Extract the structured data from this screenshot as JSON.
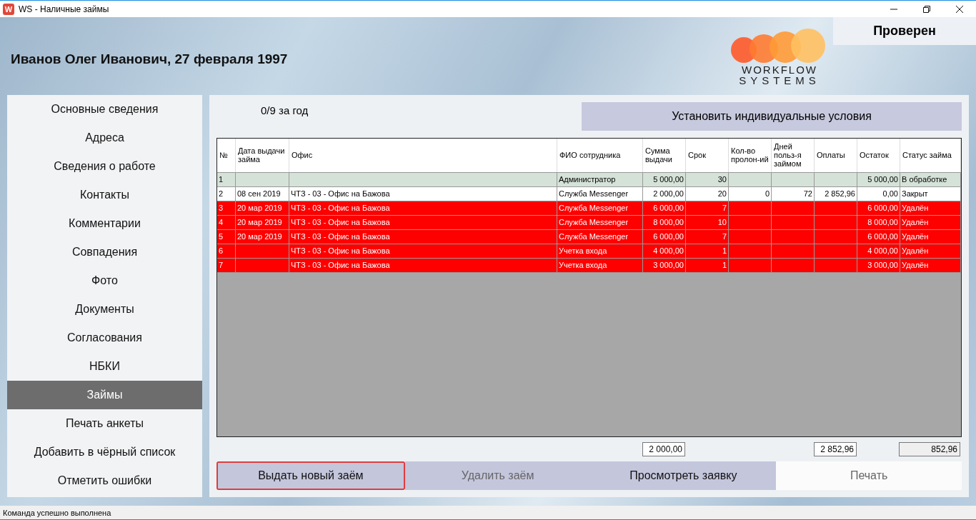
{
  "window": {
    "title": "WS - Наличные займы",
    "icon_letter": "W"
  },
  "header": {
    "client": "Иванов Олег Иванович, 27 февраля 1997",
    "check_status": "Проверен",
    "logo": {
      "line_1": "WORKFLOW",
      "line_2": "SYSTEMS"
    }
  },
  "sidebar": {
    "items": [
      {
        "label": "Основные сведения",
        "selected": false
      },
      {
        "label": "Адреса",
        "selected": false
      },
      {
        "label": "Сведения о работе",
        "selected": false
      },
      {
        "label": "Контакты",
        "selected": false
      },
      {
        "label": "Комментарии",
        "selected": false
      },
      {
        "label": "Совпадения",
        "selected": false
      },
      {
        "label": "Фото",
        "selected": false
      },
      {
        "label": "Документы",
        "selected": false
      },
      {
        "label": "Согласования",
        "selected": false
      },
      {
        "label": "НБКИ",
        "selected": false
      },
      {
        "label": "Займы",
        "selected": true
      },
      {
        "label": "Печать анкеты",
        "selected": false
      },
      {
        "label": "Добавить в чёрный список",
        "selected": false
      },
      {
        "label": "Отметить ошибки",
        "selected": false
      }
    ]
  },
  "loans_count": "0/9 за год",
  "conditions_button": "Установить индивидуальные условия",
  "table": {
    "columns": [
      "№",
      "Дата выдачи займа",
      "Офис",
      "ФИО сотрудника",
      "Сумма выдачи",
      "Срок",
      "Кол-во пролон-ий",
      "Дней польз-я займом",
      "Оплаты",
      "Остаток",
      "Статус займа"
    ],
    "rows": [
      {
        "kind": "pending",
        "cells": [
          "1",
          "",
          "",
          "Администратор",
          "5 000,00",
          "30",
          "",
          "",
          "",
          "5 000,00",
          "В обработке"
        ]
      },
      {
        "kind": "closed",
        "cells": [
          "2",
          "08 сен 2019",
          "ЧТЗ - 03 - Офис на Бажова",
          "Служба Messenger",
          "2 000,00",
          "20",
          "0",
          "72",
          "2 852,96",
          "0,00",
          "Закрыт"
        ]
      },
      {
        "kind": "deleted",
        "cells": [
          "3",
          "20 мар 2019",
          "ЧТЗ - 03 - Офис на Бажова",
          "Служба Messenger",
          "6 000,00",
          "7",
          "",
          "",
          "",
          "6 000,00",
          "Удалён"
        ]
      },
      {
        "kind": "deleted",
        "cells": [
          "4",
          "20 мар 2019",
          "ЧТЗ - 03 - Офис на Бажова",
          "Служба Messenger",
          "8 000,00",
          "10",
          "",
          "",
          "",
          "8 000,00",
          "Удалён"
        ]
      },
      {
        "kind": "deleted",
        "cells": [
          "5",
          "20 мар 2019",
          "ЧТЗ - 03 - Офис на Бажова",
          "Служба Messenger",
          "6 000,00",
          "7",
          "",
          "",
          "",
          "6 000,00",
          "Удалён"
        ]
      },
      {
        "kind": "deleted",
        "cells": [
          "6",
          "",
          "ЧТЗ - 03 - Офис на Бажова",
          "Учетка входа",
          "4 000,00",
          "1",
          "",
          "",
          "",
          "4 000,00",
          "Удалён"
        ]
      },
      {
        "kind": "deleted",
        "cells": [
          "7",
          "",
          "ЧТЗ - 03 - Офис на Бажова",
          "Учетка входа",
          "3 000,00",
          "1",
          "",
          "",
          "",
          "3 000,00",
          "Удалён"
        ]
      }
    ]
  },
  "totals": {
    "amount": {
      "value": "2 000,00",
      "disabled": false
    },
    "payments": {
      "value": "2 852,96",
      "disabled": false
    },
    "balance": {
      "value": "852,96",
      "disabled": true
    }
  },
  "buttons": [
    {
      "label": "Выдать новый заём",
      "kind": "tinted",
      "focused": true,
      "disabled": false
    },
    {
      "label": "Удалить заём",
      "kind": "tinted",
      "focused": false,
      "disabled": true
    },
    {
      "label": "Просмотреть заявку",
      "kind": "tinted",
      "focused": false,
      "disabled": false
    },
    {
      "label": "Печать",
      "kind": "light",
      "focused": false,
      "disabled": true
    }
  ],
  "status_bar": "Команда успешно выполнена"
}
